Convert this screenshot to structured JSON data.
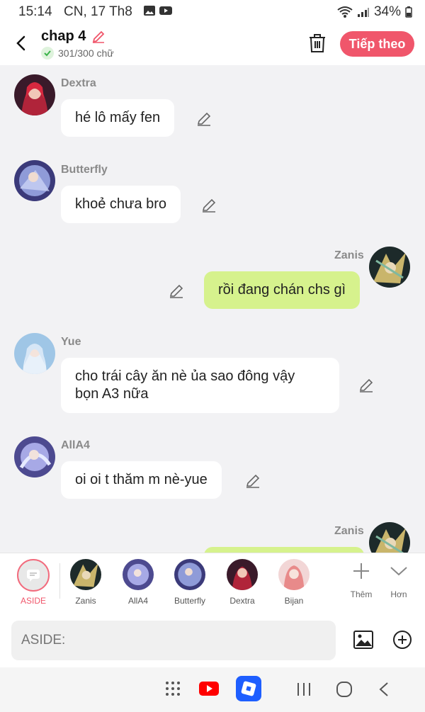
{
  "status": {
    "time": "15:14",
    "date": "CN, 17 Th8",
    "battery": "34%"
  },
  "header": {
    "title": "chap 4",
    "count": "301/300 chữ",
    "next_label": "Tiếp theo"
  },
  "messages": [
    {
      "name": "Dextra",
      "text": "hé lô mấy fen",
      "side": "left"
    },
    {
      "name": "Butterfly",
      "text": "khoẻ chưa bro",
      "side": "left"
    },
    {
      "name": "Zanis",
      "text": "rồi đang chán chs gì",
      "side": "right"
    },
    {
      "name": "Yue",
      "text_line1": "cho trái cây ăn nè ủa sao đông vậy",
      "text_line2": "bọn A3 nữa",
      "side": "left"
    },
    {
      "name": "AllA4",
      "text": "oi oi t thăm m nè-yue",
      "side": "left"
    },
    {
      "name": "Zanis",
      "text": "",
      "side": "right"
    }
  ],
  "characters": [
    {
      "name": "ASIDE"
    },
    {
      "name": "Zanis"
    },
    {
      "name": "AllA4"
    },
    {
      "name": "Butterfly"
    },
    {
      "name": "Dextra"
    },
    {
      "name": "Bijan"
    }
  ],
  "charbar": {
    "add_label": "Thêm",
    "more_label": "Hơn"
  },
  "input": {
    "placeholder": "ASIDE:"
  },
  "colors": {
    "accent": "#f0566b",
    "my_bubble": "#d6f28d",
    "background": "#f2f2f4"
  }
}
